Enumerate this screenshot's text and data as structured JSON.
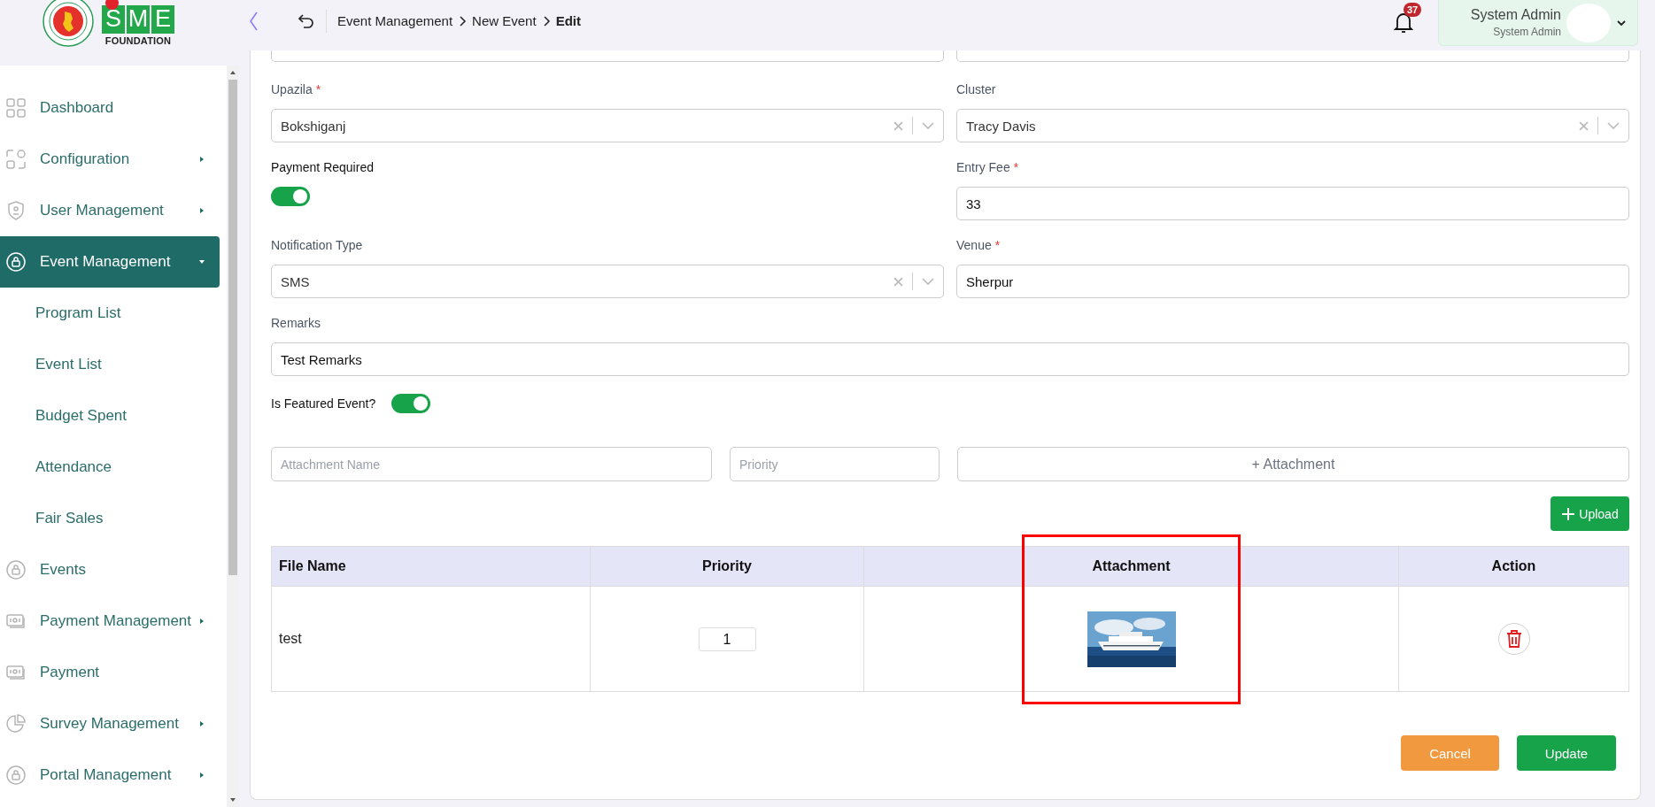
{
  "logo": {
    "letters": [
      "S",
      "M",
      "E"
    ],
    "caption": "FOUNDATION"
  },
  "header": {
    "breadcrumb": [
      {
        "label": "Event Management",
        "current": false
      },
      {
        "label": "New Event",
        "current": false
      },
      {
        "label": "Edit",
        "current": true
      }
    ],
    "notification_count": "37",
    "user": {
      "name": "System Admin",
      "role": "System Admin"
    }
  },
  "sidebar": {
    "items": [
      {
        "label": "Dashboard",
        "selected": false,
        "kind": "link"
      },
      {
        "label": "Configuration",
        "selected": false,
        "kind": "group",
        "expanded": false
      },
      {
        "label": "User Management",
        "selected": false,
        "kind": "group",
        "expanded": false
      },
      {
        "label": "Event Management",
        "selected": true,
        "kind": "group",
        "expanded": true,
        "children": [
          {
            "label": "Program List",
            "selected": false
          },
          {
            "label": "Event List",
            "selected": false
          },
          {
            "label": "Budget Spent",
            "selected": false
          },
          {
            "label": "Attendance",
            "selected": false
          },
          {
            "label": "Fair Sales",
            "selected": false
          }
        ]
      },
      {
        "label": "Events",
        "selected": false,
        "kind": "link"
      },
      {
        "label": "Payment Management",
        "selected": false,
        "kind": "group",
        "expanded": false
      },
      {
        "label": "Payment",
        "selected": false,
        "kind": "link"
      },
      {
        "label": "Survey Management",
        "selected": false,
        "kind": "group",
        "expanded": false
      },
      {
        "label": "Portal Management",
        "selected": false,
        "kind": "group",
        "expanded": false
      }
    ]
  },
  "form": {
    "rows": [
      [
        {
          "kind": "select-partial"
        },
        {
          "kind": "select-partial"
        }
      ],
      [
        {
          "kind": "select",
          "label": "Upazila",
          "required_mark": "*",
          "value": "Bokshiganj"
        },
        {
          "kind": "select",
          "label": "Cluster",
          "value": "Tracy Davis"
        }
      ],
      [
        {
          "kind": "toggle",
          "label": "Payment Required",
          "on": true
        },
        {
          "kind": "text",
          "label": "Entry Fee",
          "required_mark": "*",
          "value": "33"
        }
      ],
      [
        {
          "kind": "select",
          "label": "Notification Type",
          "value": "SMS"
        },
        {
          "kind": "text",
          "label": "Venue",
          "required_mark": "*",
          "value": "Sherpur"
        }
      ],
      [
        {
          "kind": "text",
          "label": "Remarks",
          "value": "Test Remarks"
        }
      ],
      [
        {
          "kind": "toggle-inline",
          "label": "Is Featured Event?",
          "on": true
        }
      ]
    ]
  },
  "attachment_form": {
    "name_placeholder": "Attachment Name",
    "priority_placeholder": "Priority",
    "add_label": "+ Attachment",
    "upload_label": "Upload"
  },
  "table": {
    "columns": [
      "File Name",
      "Priority",
      "Attachment",
      "Action"
    ],
    "rows": [
      {
        "file_name": "test",
        "priority": "1"
      }
    ]
  },
  "actions": {
    "cancel": "Cancel",
    "update": "Update"
  }
}
